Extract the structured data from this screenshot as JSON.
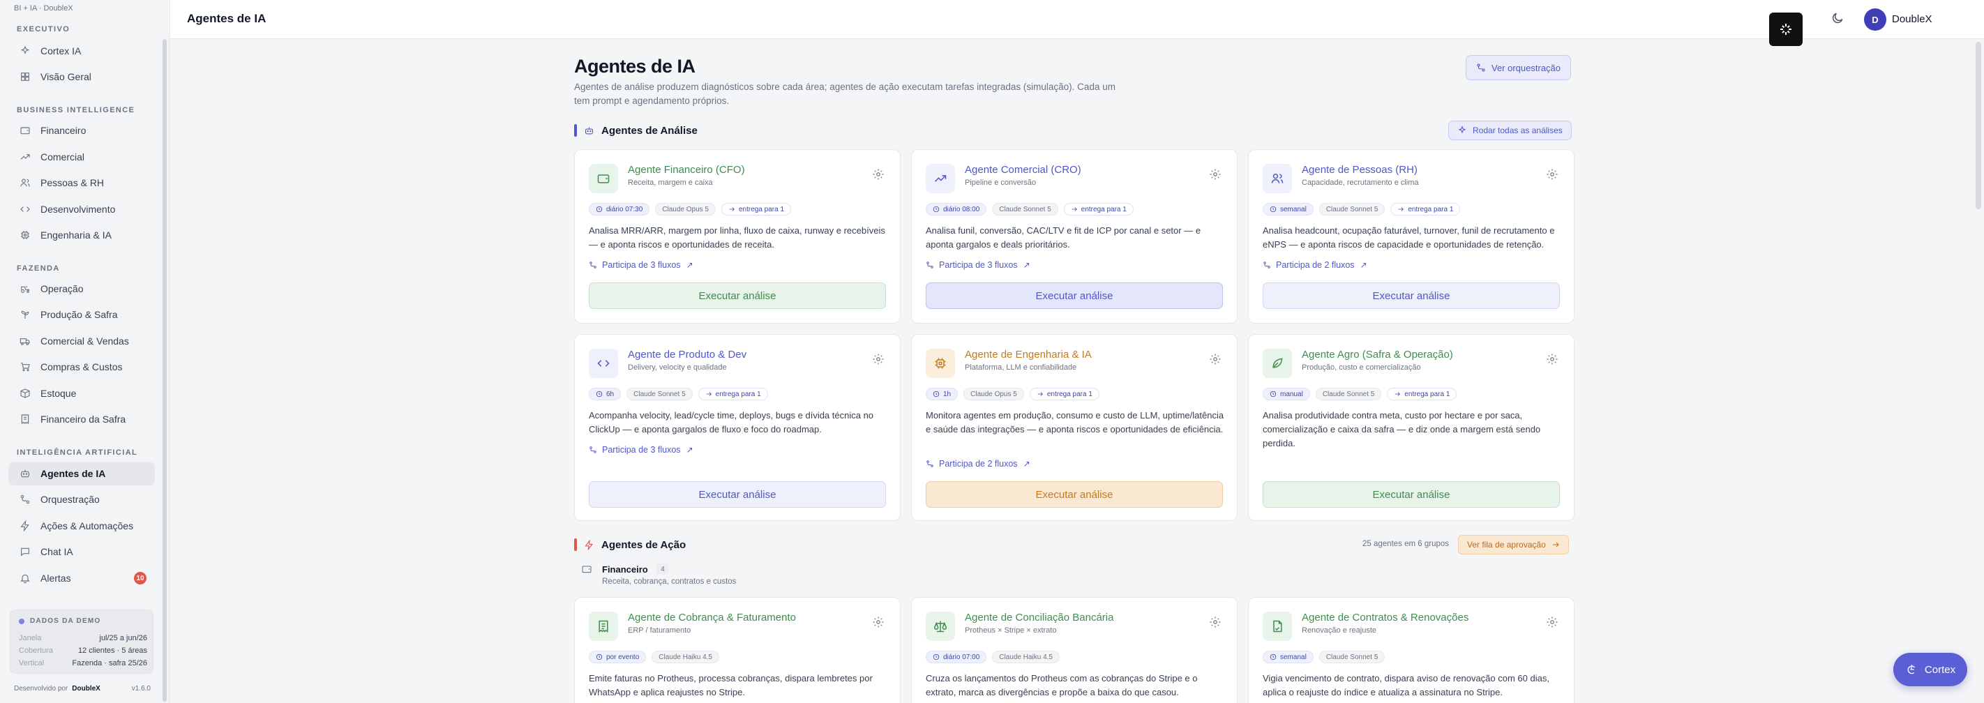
{
  "app": {
    "brand": "BI + IA · DoubleX",
    "page_title": "Agentes de IA"
  },
  "sidebar": {
    "sections": [
      {
        "title": "EXECUTIVO"
      },
      {
        "title": "BUSINESS INTELLIGENCE"
      },
      {
        "title": "FAZENDA"
      },
      {
        "title": "INTELIGÊNCIA ARTIFICIAL"
      }
    ],
    "items": [
      {
        "label": "Cortex IA"
      },
      {
        "label": "Visão Geral"
      },
      {
        "label": "Financeiro"
      },
      {
        "label": "Comercial"
      },
      {
        "label": "Pessoas & RH"
      },
      {
        "label": "Desenvolvimento"
      },
      {
        "label": "Engenharia & IA"
      },
      {
        "label": "Operação"
      },
      {
        "label": "Produção & Safra"
      },
      {
        "label": "Comercial & Vendas"
      },
      {
        "label": "Compras & Custos"
      },
      {
        "label": "Estoque"
      },
      {
        "label": "Financeiro da Safra"
      },
      {
        "label": "Agentes de IA"
      },
      {
        "label": "Orquestração"
      },
      {
        "label": "Ações & Automações"
      },
      {
        "label": "Chat IA"
      },
      {
        "label": "Alertas",
        "badge": "10"
      }
    ],
    "demo": {
      "title": "DADOS DA DEMO",
      "rows": [
        {
          "k": "Janela",
          "v": "jul/25 a jun/26"
        },
        {
          "k": "Cobertura",
          "v": "12 clientes · 5 áreas"
        },
        {
          "k": "Vertical",
          "v": "Fazenda · safra 25/26"
        }
      ]
    },
    "footer": {
      "prefix": "Desenvolvido por",
      "brand": "DoubleX",
      "version": "v1.6.0"
    }
  },
  "topbar": {
    "title": "Agentes de IA",
    "user_initial": "D",
    "user_name": "DoubleX"
  },
  "header": {
    "title": "Agentes de IA",
    "description": "Agentes de análise produzem diagnósticos sobre cada área; agentes de ação executam tarefas integradas (simulação). Cada um tem prompt e agendamento próprios.",
    "orchestration_button": "Ver orquestração"
  },
  "analysis": {
    "title": "Agentes de Análise",
    "run_all_button": "Rodar todas as análises",
    "cards": [
      {
        "name": "Agente Financeiro (CFO)",
        "sub": "Receita, margem e caixa",
        "freq": "diário 07:30",
        "model": "Claude Opus 5",
        "flow": "entrega para 1",
        "desc": "Analisa MRR/ARR, margem por linha, fluxo de caixa, runway e recebíveis — e aponta riscos e oportunidades de receita.",
        "link": "Participa de 3 fluxos",
        "button": "Executar análise"
      },
      {
        "name": "Agente Comercial (CRO)",
        "sub": "Pipeline e conversão",
        "freq": "diário 08:00",
        "model": "Claude Sonnet 5",
        "flow": "entrega para 1",
        "desc": "Analisa funil, conversão, CAC/LTV e fit de ICP por canal e setor — e aponta gargalos e deals prioritários.",
        "link": "Participa de 3 fluxos",
        "button": "Executar análise"
      },
      {
        "name": "Agente de Pessoas (RH)",
        "sub": "Capacidade, recrutamento e clima",
        "freq": "semanal",
        "model": "Claude Sonnet 5",
        "flow": "entrega para 1",
        "desc": "Analisa headcount, ocupação faturável, turnover, funil de recrutamento e eNPS — e aponta riscos de capacidade e oportunidades de retenção.",
        "link": "Participa de 2 fluxos",
        "button": "Executar análise"
      },
      {
        "name": "Agente de Produto & Dev",
        "sub": "Delivery, velocity e qualidade",
        "freq": "6h",
        "model": "Claude Sonnet 5",
        "flow": "entrega para 1",
        "desc": "Acompanha velocity, lead/cycle time, deploys, bugs e dívida técnica no ClickUp — e aponta gargalos de fluxo e foco do roadmap.",
        "link": "Participa de 3 fluxos",
        "button": "Executar análise"
      },
      {
        "name": "Agente de Engenharia & IA",
        "sub": "Plataforma, LLM e confiabilidade",
        "freq": "1h",
        "model": "Claude Opus 5",
        "flow": "entrega para 1",
        "desc": "Monitora agentes em produção, consumo e custo de LLM, uptime/latência e saúde das integrações — e aponta riscos e oportunidades de eficiência.",
        "link": "Participa de 2 fluxos",
        "button": "Executar análise"
      },
      {
        "name": "Agente Agro (Safra & Operação)",
        "sub": "Produção, custo e comercialização",
        "freq": "manual",
        "model": "Claude Sonnet 5",
        "flow": "entrega para 1",
        "desc": "Analisa produtividade contra meta, custo por hectare e por saca, comercialização e caixa da safra — e diz onde a margem está sendo perdida.",
        "link": "",
        "button": "Executar análise"
      }
    ]
  },
  "action": {
    "title": "Agentes de Ação",
    "summary": "25 agentes em 6 grupos",
    "queue_button": "Ver fila de aprovação",
    "group": {
      "name": "Financeiro",
      "count": "4",
      "sub": "Receita, cobrança, contratos e custos"
    },
    "cards": [
      {
        "name": "Agente de Cobrança & Faturamento",
        "sub": "ERP / faturamento",
        "freq": "por evento",
        "model": "Claude Haiku 4.5",
        "desc": "Emite faturas no Protheus, processa cobranças, dispara lembretes por WhatsApp e aplica reajustes no Stripe."
      },
      {
        "name": "Agente de Conciliação Bancária",
        "sub": "Protheus × Stripe × extrato",
        "freq": "diário 07:00",
        "model": "Claude Haiku 4.5",
        "desc": "Cruza os lançamentos do Protheus com as cobranças do Stripe e o extrato, marca as divergências e propõe a baixa do que casou."
      },
      {
        "name": "Agente de Contratos & Renovações",
        "sub": "Renovação e reajuste",
        "freq": "semanal",
        "model": "Claude Sonnet 5",
        "desc": "Vigia vencimento de contrato, dispara aviso de renovação com 60 dias, aplica o reajuste do índice e atualiza a assinatura no Stripe."
      }
    ]
  },
  "fab": {
    "label": "Cortex"
  },
  "colors": {
    "green_accent": "#3f8d4e",
    "indigo_accent": "#4f57c9",
    "amber_accent": "#c27a1e",
    "brand": "#5a5fd6",
    "badge_red": "#e0564a"
  }
}
